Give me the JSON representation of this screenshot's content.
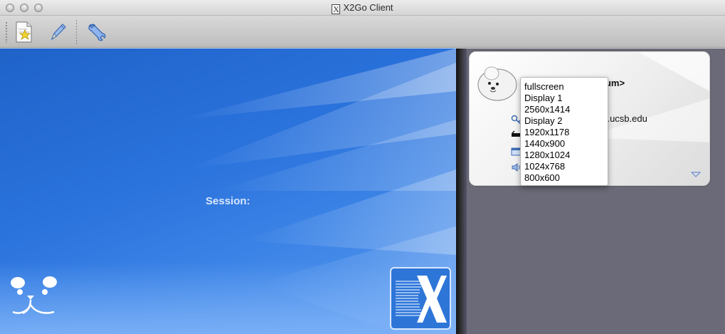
{
  "window": {
    "title": "X2Go Client"
  },
  "toolbar": {
    "items": [
      {
        "name": "new-session",
        "icon": "new-session-icon"
      },
      {
        "name": "edit-session",
        "icon": "pencil-icon"
      },
      {
        "name": "preferences",
        "icon": "wrench-icon"
      }
    ]
  },
  "main": {
    "session_label": "Session:"
  },
  "session_card": {
    "name_fragment": "num>",
    "server_fragment": "ceas.ucsb.edu"
  },
  "resolution_menu": {
    "options": [
      "fullscreen",
      "Display 1",
      "2560x1414",
      "Display 2",
      "1920x1178",
      "1440x900",
      "1280x1024",
      "1024x768",
      "800x600"
    ]
  },
  "colors": {
    "left_pane_blue": "#2a72dc",
    "right_pane_bg": "#6a6a78",
    "label_text": "#d8e6fb"
  }
}
